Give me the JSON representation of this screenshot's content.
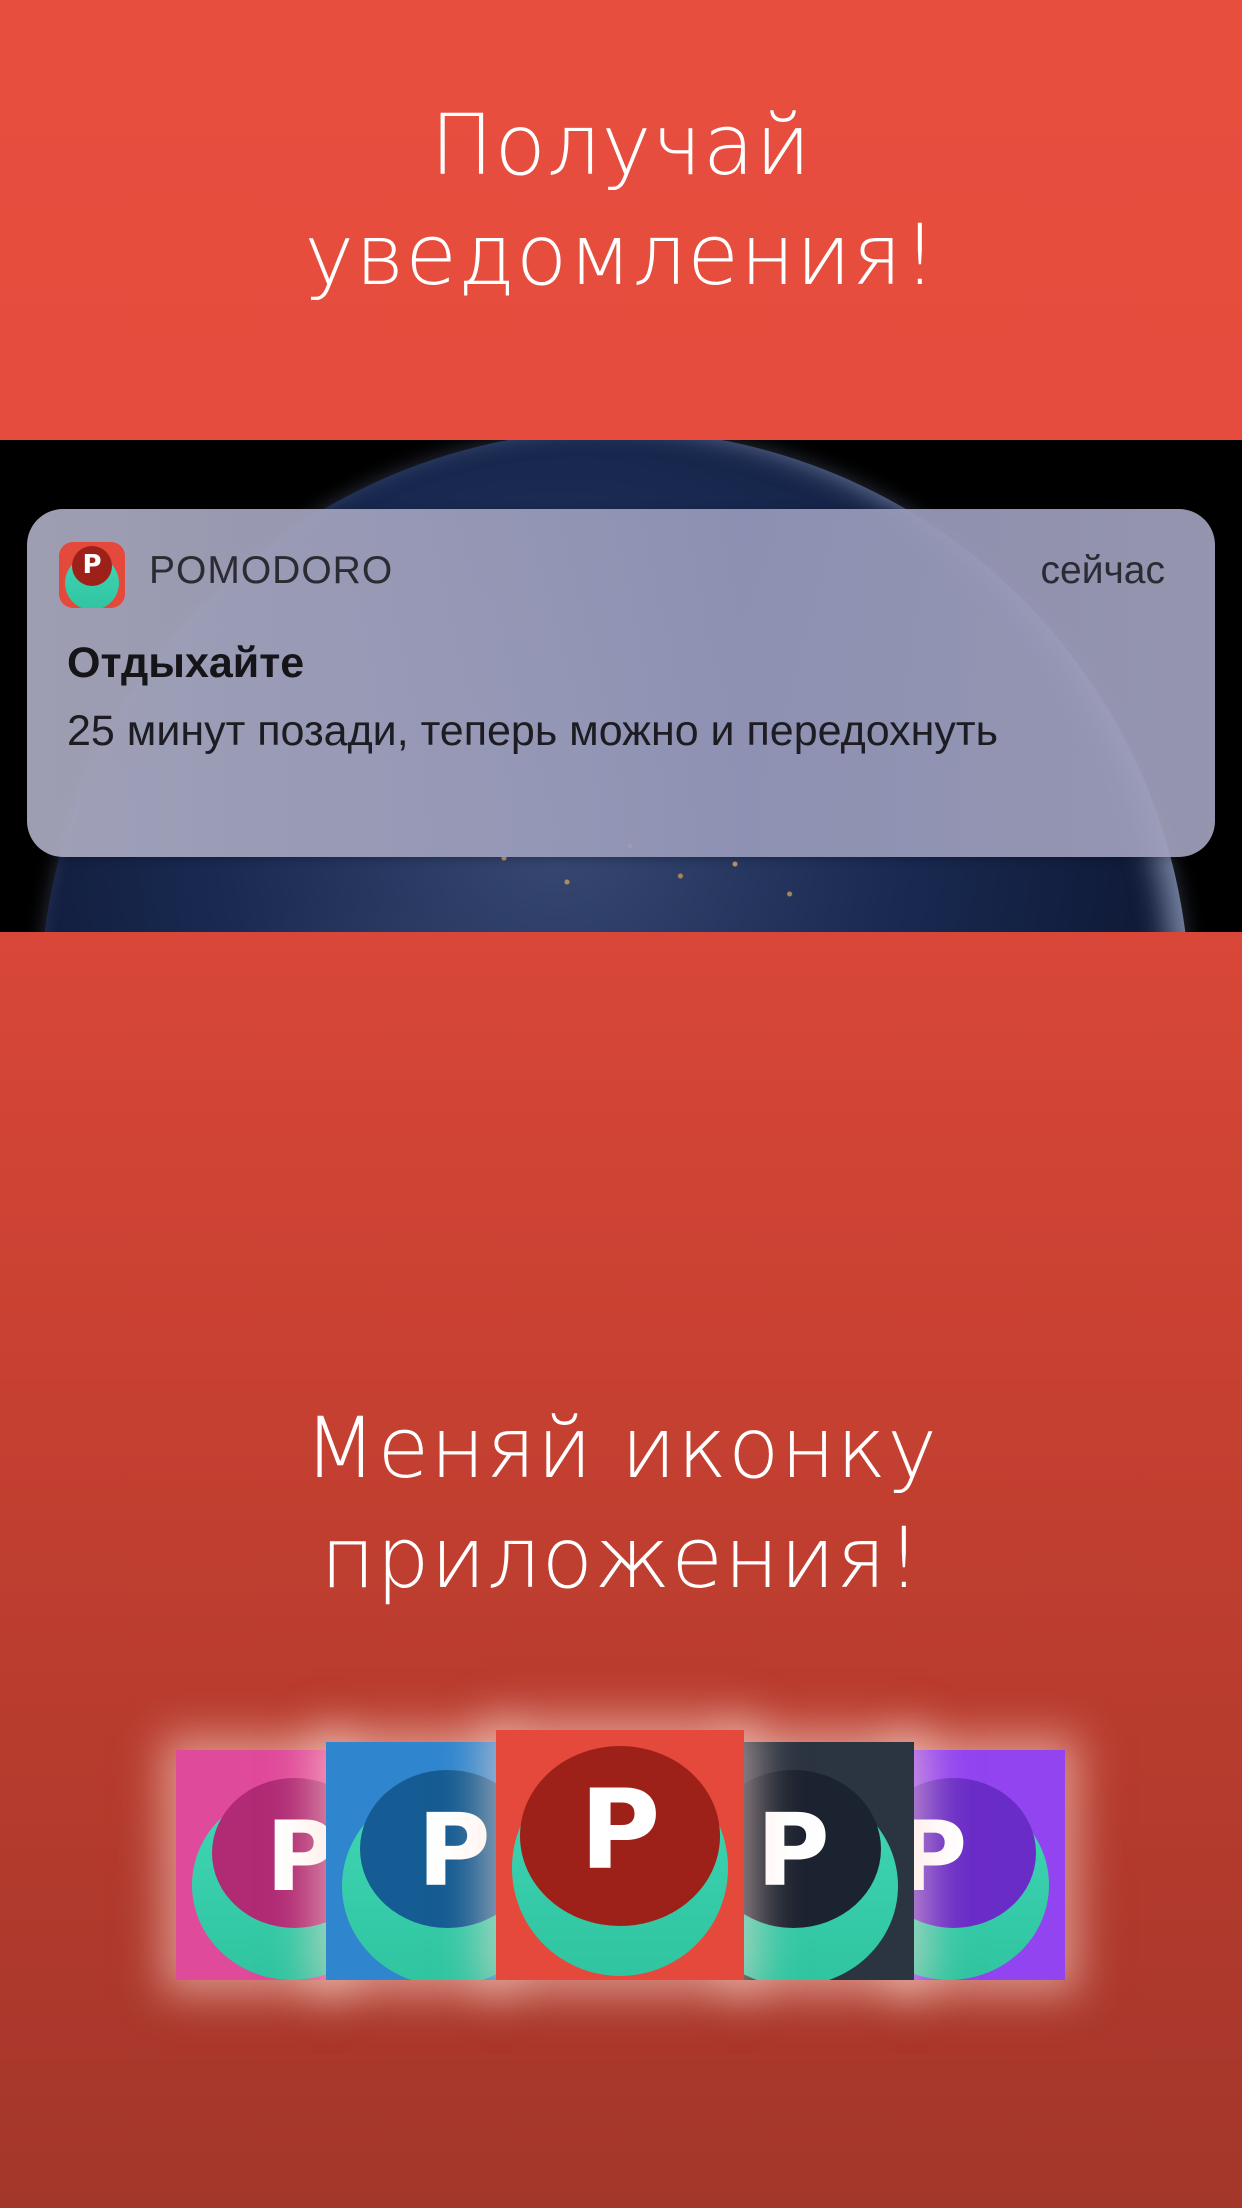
{
  "headline_top": [
    "Получай",
    "уведомления!"
  ],
  "notification": {
    "app_name": "POMODORO",
    "time": "сейчас",
    "title": "Отдыхайте",
    "body": "25 минут позади, теперь можно и передохнуть",
    "icon_letter": "P"
  },
  "headline_bottom": [
    "Меняй иконку",
    "приложения!"
  ],
  "icon_variants": [
    {
      "name": "pink",
      "letter": "P",
      "bg": "#e04a9a",
      "inner": "#b02a74"
    },
    {
      "name": "blue",
      "letter": "P",
      "bg": "#2f86cf",
      "inner": "#145c93"
    },
    {
      "name": "red",
      "letter": "P",
      "bg": "#e5493b",
      "inner": "#9e2119"
    },
    {
      "name": "dark",
      "letter": "P",
      "bg": "#2b3441",
      "inner": "#1c2330"
    },
    {
      "name": "purple",
      "letter": "P",
      "bg": "#9144f0",
      "inner": "#6a2cc7"
    }
  ]
}
